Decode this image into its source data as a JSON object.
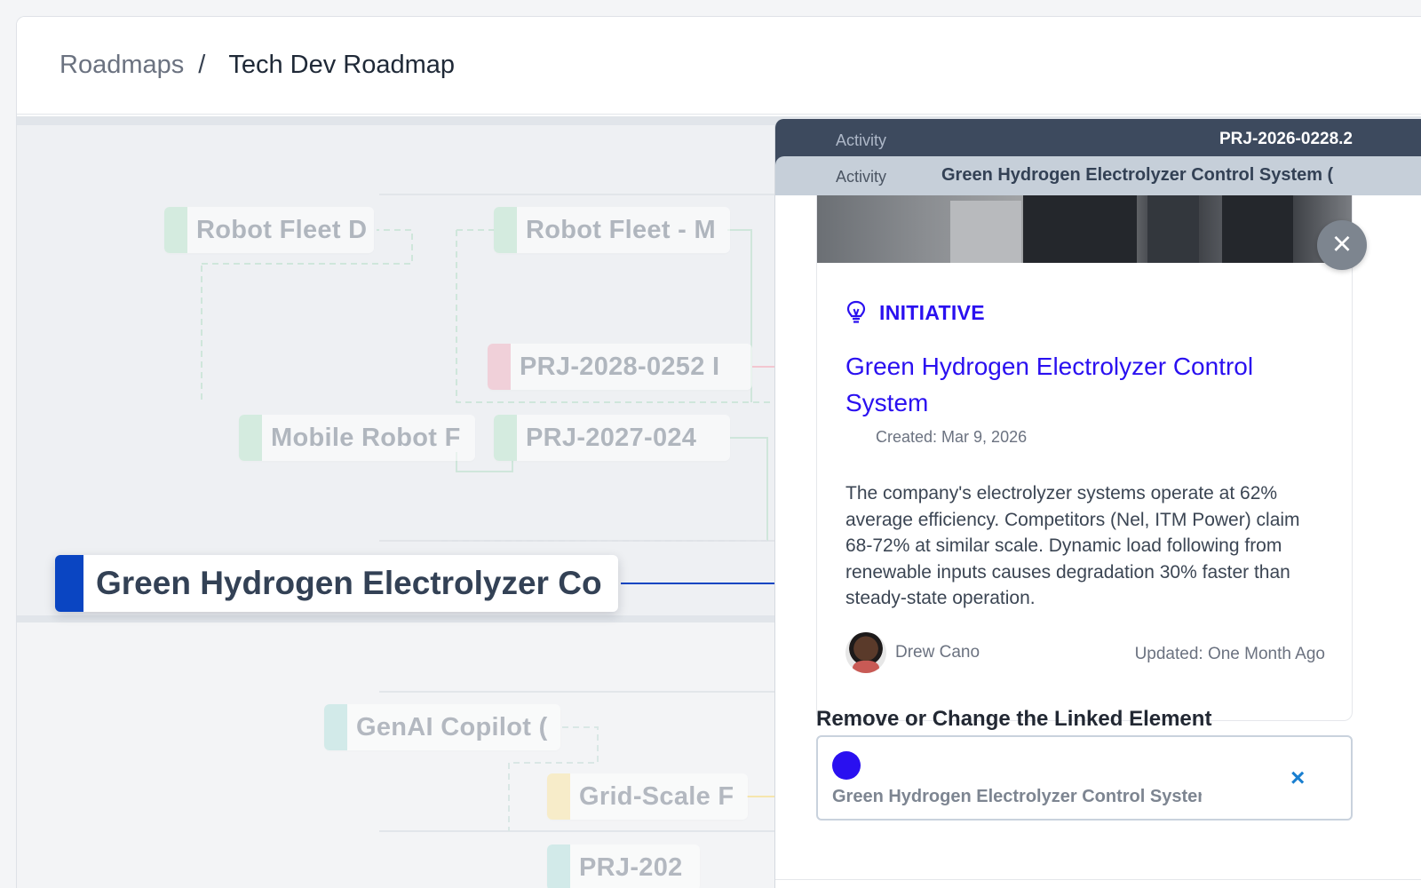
{
  "breadcrumb": {
    "parent": "Roadmaps",
    "separator": "/",
    "current": "Tech Dev Roadmap"
  },
  "canvas": {
    "nodes": [
      {
        "label": "Robot Fleet D",
        "color": "#bfe8cf"
      },
      {
        "label": "Robot Fleet - M",
        "color": "#bfe8cf"
      },
      {
        "label": "PRJ-2028-0252 I",
        "color": "#f3b7c4"
      },
      {
        "label": "Mobile Robot F",
        "color": "#bfe8cf"
      },
      {
        "label": "PRJ-2027-024",
        "color": "#bfe8cf"
      },
      {
        "label": "GenAI Copilot (",
        "color": "#b8e3df"
      },
      {
        "label": "Grid-Scale F",
        "color": "#fbe7a6"
      },
      {
        "label": "PRJ-202",
        "color": "#b8e3df"
      }
    ],
    "selected_node": {
      "label": "Green Hydrogen Electrolyzer Co",
      "color": "#0a45c2"
    }
  },
  "panel": {
    "tab_back": {
      "label": "Activity",
      "id": "PRJ-2026-0228.2"
    },
    "tab_front": {
      "label": "Activity",
      "title": "Green Hydrogen Electrolyzer Control System ("
    },
    "close_label": "×",
    "card": {
      "kind_icon": "lightbulb-icon",
      "kind": "INITIATIVE",
      "title": "Green Hydrogen Electrolyzer Control System",
      "created": "Created: Mar 9, 2026",
      "description": "The company's electrolyzer systems operate at 62% average efficiency. Competitors (Nel, ITM Power) claim 68-72% at similar scale. Dynamic load following from renewable inputs causes degradation 30% faster than steady-state operation.",
      "owner": "Drew Cano",
      "updated": "Updated: One Month Ago"
    },
    "link_section": {
      "heading": "Remove or Change the Linked Element",
      "linked_name": "Green Hydrogen Electrolyzer Control System",
      "dot_color": "#2a10f0",
      "remove_label": "×"
    }
  },
  "colors": {
    "accent": "#2a10f0",
    "selected_bar": "#0a45c2",
    "panel_tab_dark": "#3d4a5e"
  }
}
